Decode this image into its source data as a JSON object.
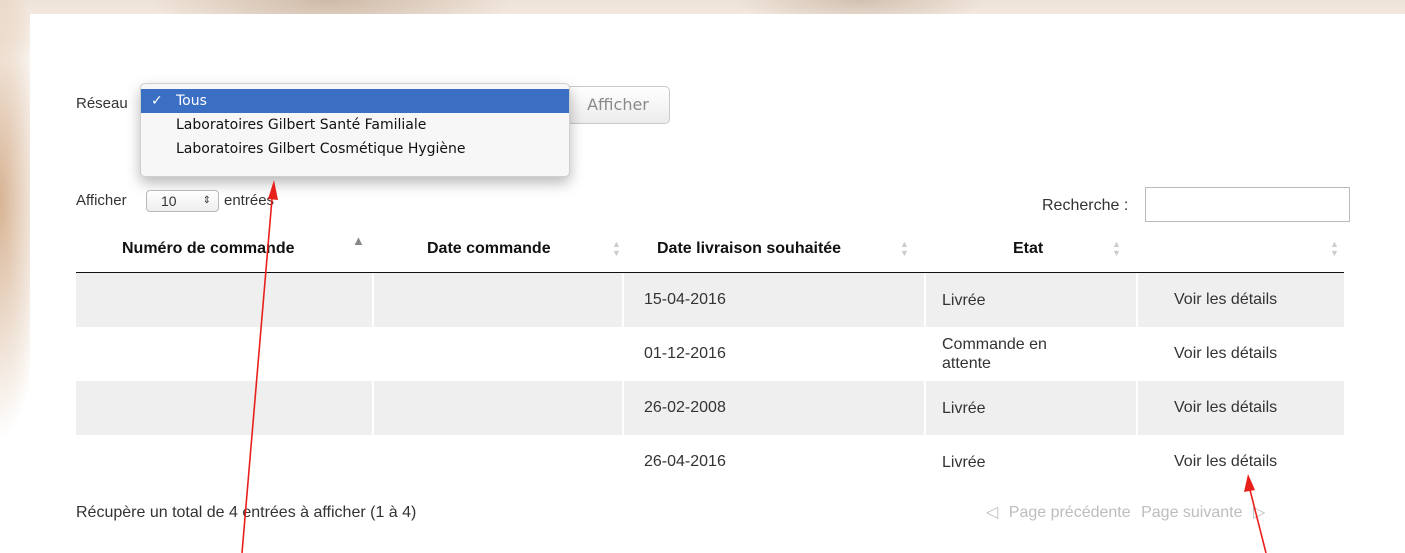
{
  "filter": {
    "label": "Réseau",
    "options": [
      {
        "check": "✓",
        "label": "Tous",
        "selected": true
      },
      {
        "check": "",
        "label": "Laboratoires Gilbert Santé Familiale",
        "selected": false
      },
      {
        "check": "",
        "label": "Laboratoires Gilbert Cosmétique Hygiène",
        "selected": false
      }
    ],
    "button_label": "Afficher"
  },
  "length": {
    "prefix": "Afficher",
    "value": "10",
    "arrows": "▲▼",
    "suffix": "entrées"
  },
  "search": {
    "label": "Recherche :",
    "value": ""
  },
  "table": {
    "columns": [
      {
        "label": "Numéro de commande",
        "sort": "▲"
      },
      {
        "label": "Date commande",
        "sort": "▲▼"
      },
      {
        "label": "Date livraison souhaitée",
        "sort": "▲▼"
      },
      {
        "label": "Etat",
        "sort": "▲▼"
      },
      {
        "label": "",
        "sort": "▲▼"
      }
    ],
    "rows": [
      {
        "numero": "",
        "date_commande": "",
        "date_livraison": "15-04-2016",
        "etat": "Livrée",
        "action": "Voir les détails"
      },
      {
        "numero": "",
        "date_commande": "",
        "date_livraison": "01-12-2016",
        "etat": "Commande en attente",
        "action": "Voir les détails"
      },
      {
        "numero": "",
        "date_commande": "",
        "date_livraison": "26-02-2008",
        "etat": "Livrée",
        "action": "Voir les détails"
      },
      {
        "numero": "",
        "date_commande": "",
        "date_livraison": "26-04-2016",
        "etat": "Livrée",
        "action": "Voir les détails"
      }
    ]
  },
  "footer": {
    "info": "Récupère un total de 4 entrées à afficher (1 à 4)",
    "prev_icon": "◁",
    "prev_label": "Page précédente",
    "next_label": "Page suivante",
    "next_icon": "▷"
  },
  "colors": {
    "selected_option_bg": "#3a6fc4",
    "annotation_arrow": "#e8201c",
    "row_shade": "#efefef"
  }
}
